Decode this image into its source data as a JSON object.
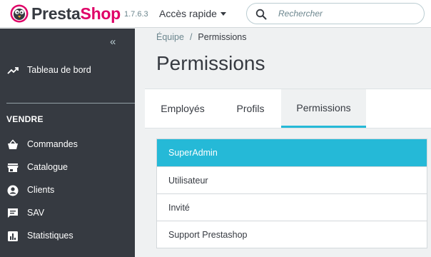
{
  "header": {
    "brand_presta": "Presta",
    "brand_shop": "Shop",
    "version": "1.7.6.3",
    "quick_access": "Accès rapide",
    "search_placeholder": "Rechercher"
  },
  "sidebar": {
    "collapse_glyph": "«",
    "dashboard": "Tableau de bord",
    "section": "VENDRE",
    "items": [
      {
        "label": "Commandes",
        "icon": "basket-icon"
      },
      {
        "label": "Catalogue",
        "icon": "store-icon"
      },
      {
        "label": "Clients",
        "icon": "account-circle-icon"
      },
      {
        "label": "SAV",
        "icon": "chat-icon"
      },
      {
        "label": "Statistiques",
        "icon": "bar-chart-icon"
      }
    ]
  },
  "breadcrumb": {
    "parent": "Équipe",
    "separator": "/",
    "current": "Permissions"
  },
  "page_title": "Permissions",
  "tabs": [
    {
      "label": "Employés",
      "active": false
    },
    {
      "label": "Profils",
      "active": false
    },
    {
      "label": "Permissions",
      "active": true
    }
  ],
  "profiles": [
    {
      "label": "SuperAdmin",
      "active": true
    },
    {
      "label": "Utilisateur",
      "active": false
    },
    {
      "label": "Invité",
      "active": false
    },
    {
      "label": "Support Prestashop",
      "active": false
    }
  ],
  "colors": {
    "accent": "#25b9d7",
    "brand_pink": "#df0067",
    "sidebar_bg": "#363a41"
  }
}
